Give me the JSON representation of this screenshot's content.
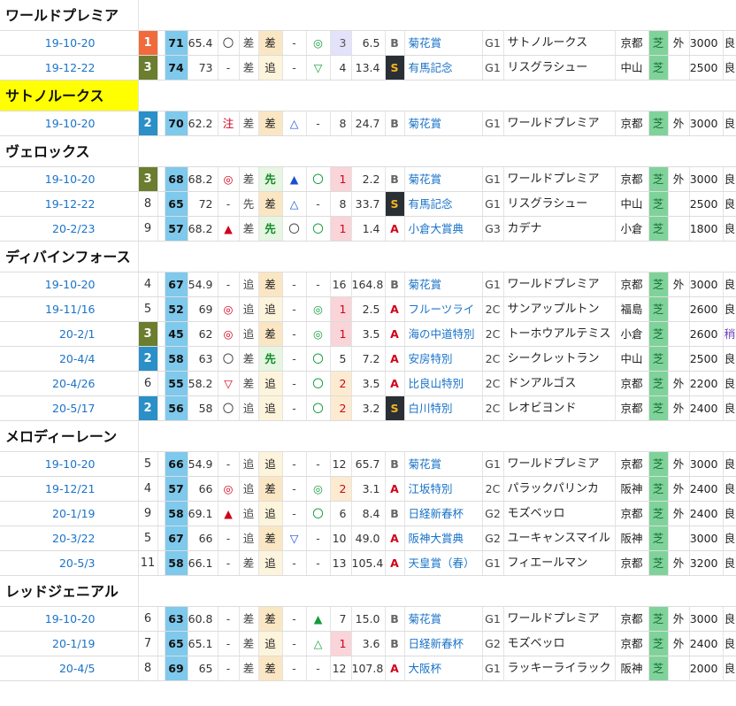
{
  "horses": [
    {
      "name": "ワールドプレミア",
      "highlight": false,
      "races": [
        {
          "date": "19-10-20",
          "rank": "1",
          "idx": "71",
          "val": "65.4",
          "m1": "〇",
          "m2": "差",
          "m3": "差",
          "m4": "-",
          "m5": "◎",
          "pop": "3",
          "odds": "6.5",
          "cls": "B",
          "race": "菊花賞",
          "grade": "G1",
          "winner": "サトノルークス",
          "venue": "京都",
          "surf": "芝",
          "inout": "外",
          "dist": "3000",
          "cond": "良"
        },
        {
          "date": "19-12-22",
          "rank": "3",
          "idx": "74",
          "val": "73",
          "m1": "-",
          "m2": "差",
          "m3": "追",
          "m4": "-",
          "m5": "▽",
          "pop": "4",
          "odds": "13.4",
          "cls": "S",
          "race": "有馬記念",
          "grade": "G1",
          "winner": "リスグラシュー",
          "venue": "中山",
          "surf": "芝",
          "inout": "",
          "dist": "2500",
          "cond": "良"
        }
      ]
    },
    {
      "name": "サトノルークス",
      "highlight": true,
      "races": [
        {
          "date": "19-10-20",
          "rank": "2",
          "idx": "70",
          "val": "62.2",
          "m1": "注",
          "m2": "差",
          "m3": "差",
          "m4": "△",
          "m5": "-",
          "pop": "8",
          "odds": "24.7",
          "cls": "B",
          "race": "菊花賞",
          "grade": "G1",
          "winner": "ワールドプレミア",
          "venue": "京都",
          "surf": "芝",
          "inout": "外",
          "dist": "3000",
          "cond": "良"
        }
      ]
    },
    {
      "name": "ヴェロックス",
      "highlight": false,
      "races": [
        {
          "date": "19-10-20",
          "rank": "3",
          "idx": "68",
          "val": "68.2",
          "m1": "◎",
          "m2": "差",
          "m3": "先",
          "m4": "▲",
          "m5": "〇",
          "pop": "1",
          "odds": "2.2",
          "cls": "B",
          "race": "菊花賞",
          "grade": "G1",
          "winner": "ワールドプレミア",
          "venue": "京都",
          "surf": "芝",
          "inout": "外",
          "dist": "3000",
          "cond": "良"
        },
        {
          "date": "19-12-22",
          "rank": "8",
          "idx": "65",
          "val": "72",
          "m1": "-",
          "m2": "先",
          "m3": "差",
          "m4": "△",
          "m5": "-",
          "pop": "8",
          "odds": "33.7",
          "cls": "S",
          "race": "有馬記念",
          "grade": "G1",
          "winner": "リスグラシュー",
          "venue": "中山",
          "surf": "芝",
          "inout": "",
          "dist": "2500",
          "cond": "良"
        },
        {
          "date": "20-2/23",
          "rank": "9",
          "idx": "57",
          "val": "68.2",
          "m1": "▲",
          "m2": "差",
          "m3": "先",
          "m4": "〇",
          "m5": "〇",
          "pop": "1",
          "odds": "1.4",
          "cls": "A",
          "race": "小倉大賞典",
          "grade": "G3",
          "winner": "カデナ",
          "venue": "小倉",
          "surf": "芝",
          "inout": "",
          "dist": "1800",
          "cond": "良"
        }
      ]
    },
    {
      "name": "ディバインフォース",
      "highlight": false,
      "races": [
        {
          "date": "19-10-20",
          "rank": "4",
          "idx": "67",
          "val": "54.9",
          "m1": "-",
          "m2": "追",
          "m3": "差",
          "m4": "-",
          "m5": "-",
          "pop": "16",
          "odds": "164.8",
          "cls": "B",
          "race": "菊花賞",
          "grade": "G1",
          "winner": "ワールドプレミア",
          "venue": "京都",
          "surf": "芝",
          "inout": "外",
          "dist": "3000",
          "cond": "良"
        },
        {
          "date": "19-11/16",
          "rank": "5",
          "idx": "52",
          "val": "69",
          "m1": "◎",
          "m2": "追",
          "m3": "追",
          "m4": "-",
          "m5": "◎",
          "pop": "1",
          "odds": "2.5",
          "cls": "A",
          "race": "フルーツライ",
          "grade": "2C",
          "winner": "サンアップルトン",
          "venue": "福島",
          "surf": "芝",
          "inout": "",
          "dist": "2600",
          "cond": "良"
        },
        {
          "date": "20-2/1",
          "rank": "3",
          "idx": "45",
          "val": "62",
          "m1": "◎",
          "m2": "追",
          "m3": "差",
          "m4": "-",
          "m5": "◎",
          "pop": "1",
          "odds": "3.5",
          "cls": "A",
          "race": "海の中道特別",
          "grade": "2C",
          "winner": "トーホウアルテミス",
          "venue": "小倉",
          "surf": "芝",
          "inout": "",
          "dist": "2600",
          "cond": "稍"
        },
        {
          "date": "20-4/4",
          "rank": "2",
          "idx": "58",
          "val": "63",
          "m1": "〇",
          "m2": "差",
          "m3": "先",
          "m4": "-",
          "m5": "〇",
          "pop": "5",
          "odds": "7.2",
          "cls": "A",
          "race": "安房特別",
          "grade": "2C",
          "winner": "シークレットラン",
          "venue": "中山",
          "surf": "芝",
          "inout": "",
          "dist": "2500",
          "cond": "良"
        },
        {
          "date": "20-4/26",
          "rank": "6",
          "idx": "55",
          "val": "58.2",
          "m1": "▽",
          "m2": "差",
          "m3": "追",
          "m4": "-",
          "m5": "〇",
          "pop": "2",
          "odds": "3.5",
          "cls": "A",
          "race": "比良山特別",
          "grade": "2C",
          "winner": "ドンアルゴス",
          "venue": "京都",
          "surf": "芝",
          "inout": "外",
          "dist": "2200",
          "cond": "良"
        },
        {
          "date": "20-5/17",
          "rank": "2",
          "idx": "56",
          "val": "58",
          "m1": "〇",
          "m2": "追",
          "m3": "追",
          "m4": "-",
          "m5": "〇",
          "pop": "2",
          "odds": "3.2",
          "cls": "S",
          "race": "白川特別",
          "grade": "2C",
          "winner": "レオビヨンド",
          "venue": "京都",
          "surf": "芝",
          "inout": "外",
          "dist": "2400",
          "cond": "良"
        }
      ]
    },
    {
      "name": "メロディーレーン",
      "highlight": false,
      "races": [
        {
          "date": "19-10-20",
          "rank": "5",
          "idx": "66",
          "val": "54.9",
          "m1": "-",
          "m2": "追",
          "m3": "追",
          "m4": "-",
          "m5": "-",
          "pop": "12",
          "odds": "65.7",
          "cls": "B",
          "race": "菊花賞",
          "grade": "G1",
          "winner": "ワールドプレミア",
          "venue": "京都",
          "surf": "芝",
          "inout": "外",
          "dist": "3000",
          "cond": "良"
        },
        {
          "date": "19-12/21",
          "rank": "4",
          "idx": "57",
          "val": "66",
          "m1": "◎",
          "m2": "追",
          "m3": "差",
          "m4": "-",
          "m5": "◎",
          "pop": "2",
          "odds": "3.1",
          "cls": "A",
          "race": "江坂特別",
          "grade": "2C",
          "winner": "パラックパリンカ",
          "venue": "阪神",
          "surf": "芝",
          "inout": "外",
          "dist": "2400",
          "cond": "良"
        },
        {
          "date": "20-1/19",
          "rank": "9",
          "idx": "58",
          "val": "69.1",
          "m1": "▲",
          "m2": "追",
          "m3": "追",
          "m4": "-",
          "m5": "〇",
          "pop": "6",
          "odds": "8.4",
          "cls": "B",
          "race": "日経新春杯",
          "grade": "G2",
          "winner": "モズベッロ",
          "venue": "京都",
          "surf": "芝",
          "inout": "外",
          "dist": "2400",
          "cond": "良"
        },
        {
          "date": "20-3/22",
          "rank": "5",
          "idx": "67",
          "val": "66",
          "m1": "-",
          "m2": "追",
          "m3": "差",
          "m4": "▽",
          "m5": "-",
          "pop": "10",
          "odds": "49.0",
          "cls": "A",
          "race": "阪神大賞典",
          "grade": "G2",
          "winner": "ユーキャンスマイル",
          "venue": "阪神",
          "surf": "芝",
          "inout": "",
          "dist": "3000",
          "cond": "良"
        },
        {
          "date": "20-5/3",
          "rank": "11",
          "idx": "58",
          "val": "66.1",
          "m1": "-",
          "m2": "差",
          "m3": "追",
          "m4": "-",
          "m5": "-",
          "pop": "13",
          "odds": "105.4",
          "cls": "A",
          "race": "天皇賞（春）",
          "grade": "G1",
          "winner": "フィエールマン",
          "venue": "京都",
          "surf": "芝",
          "inout": "外",
          "dist": "3200",
          "cond": "良"
        }
      ]
    },
    {
      "name": "レッドジェニアル",
      "highlight": false,
      "races": [
        {
          "date": "19-10-20",
          "rank": "6",
          "idx": "63",
          "val": "60.8",
          "m1": "-",
          "m2": "差",
          "m3": "差",
          "m4": "-",
          "m5": "▲",
          "pop": "7",
          "odds": "15.0",
          "cls": "B",
          "race": "菊花賞",
          "grade": "G1",
          "winner": "ワールドプレミア",
          "venue": "京都",
          "surf": "芝",
          "inout": "外",
          "dist": "3000",
          "cond": "良"
        },
        {
          "date": "20-1/19",
          "rank": "7",
          "idx": "65",
          "val": "65.1",
          "m1": "-",
          "m2": "差",
          "m3": "追",
          "m4": "-",
          "m5": "△",
          "pop": "1",
          "odds": "3.6",
          "cls": "B",
          "race": "日経新春杯",
          "grade": "G2",
          "winner": "モズベッロ",
          "venue": "京都",
          "surf": "芝",
          "inout": "外",
          "dist": "2400",
          "cond": "良"
        },
        {
          "date": "20-4/5",
          "rank": "8",
          "idx": "69",
          "val": "65",
          "m1": "-",
          "m2": "差",
          "m3": "差",
          "m4": "-",
          "m5": "-",
          "pop": "12",
          "odds": "107.8",
          "cls": "A",
          "race": "大阪杯",
          "grade": "G1",
          "winner": "ラッキーライラック",
          "venue": "阪神",
          "surf": "芝",
          "inout": "",
          "dist": "2000",
          "cond": "良"
        }
      ]
    }
  ]
}
